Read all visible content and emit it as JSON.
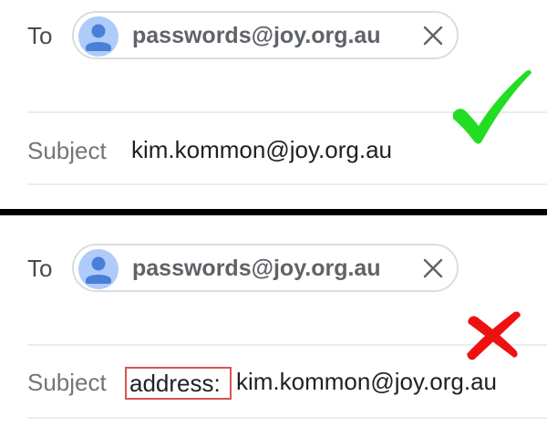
{
  "examples": [
    {
      "to_label": "To",
      "recipient": "passwords@joy.org.au",
      "subject_label": "Subject",
      "subject_prefix": "",
      "subject_value": "kim.kommon@joy.org.au",
      "verdict_icon": "check-icon",
      "verdict_color": "#22dd22"
    },
    {
      "to_label": "To",
      "recipient": "passwords@joy.org.au",
      "subject_label": "Subject",
      "subject_prefix": "address:",
      "subject_value": "kim.kommon@joy.org.au",
      "verdict_icon": "cross-icon",
      "verdict_color": "#ee1111"
    }
  ],
  "colors": {
    "avatar_bg": "#aecbfa",
    "avatar_fg": "#4a7fd8",
    "highlight_border": "#d9534f",
    "divider": "#000000"
  }
}
